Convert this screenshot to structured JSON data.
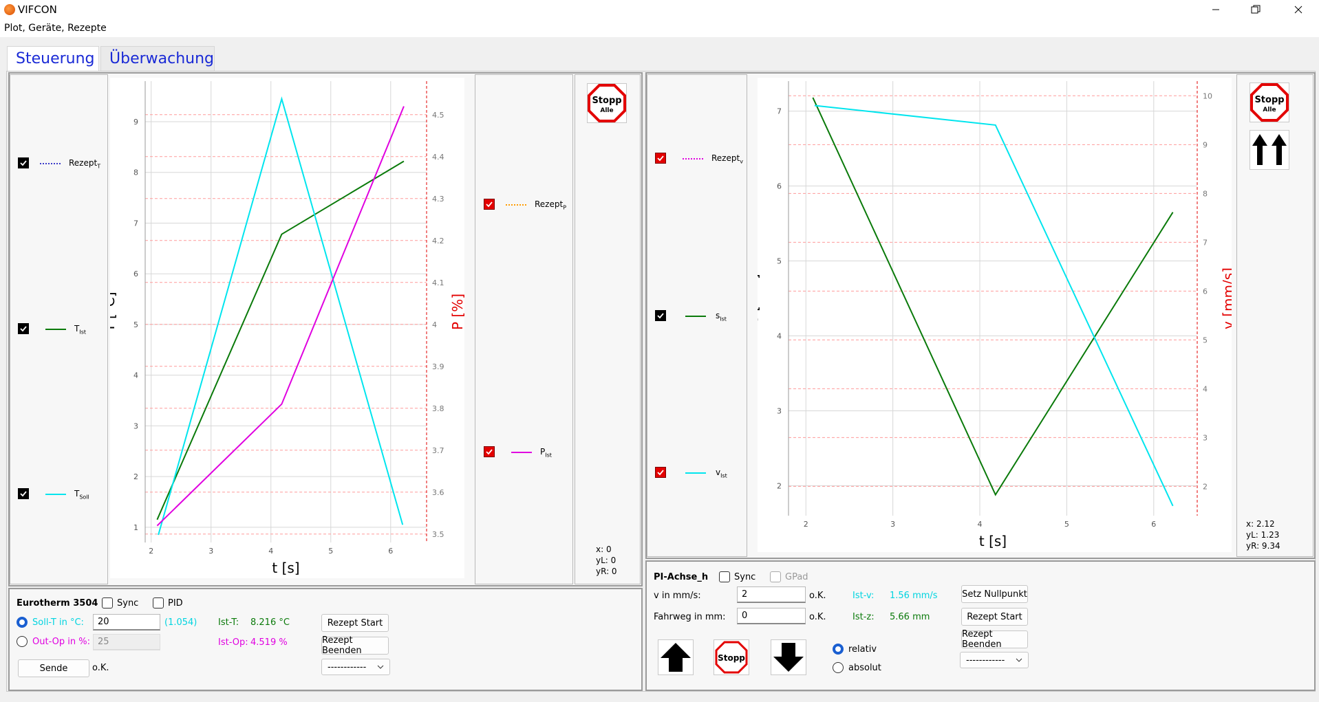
{
  "window": {
    "title": "VIFCON",
    "menu": "Plot, Geräte, Rezepte",
    "controls": {
      "minimize_icon": "minimize-icon",
      "maximize_icon": "maximize-icon",
      "close_icon": "close-icon"
    }
  },
  "tabs": [
    {
      "label": "Steuerung",
      "active": true
    },
    {
      "label": "Überwachung",
      "active": false
    }
  ],
  "colors": {
    "accent": "#1a2ad6",
    "cyan": "#00e5ee",
    "green": "#0a7a0a",
    "magenta": "#e000e0",
    "red": "#e30000",
    "orange": "#ff9c00",
    "blue": "#3a3ac8"
  },
  "left": {
    "legend_left": [
      {
        "name": "Rezept",
        "sub": "T",
        "style": "dotted",
        "color": "#3a3ac8"
      },
      {
        "name": "T",
        "sub": "Ist",
        "style": "solid",
        "color": "#0a7a0a"
      },
      {
        "name": "T",
        "sub": "Soll",
        "style": "solid",
        "color": "#00e5ee"
      }
    ],
    "legend_right": [
      {
        "name": "Rezept",
        "sub": "P",
        "style": "dotted",
        "color": "#ff9c00"
      },
      {
        "name": "P",
        "sub": "Ist",
        "style": "solid",
        "color": "#e000e0"
      }
    ],
    "stopp": {
      "label1": "Stopp",
      "label2": "Alle"
    },
    "coords": {
      "x": "x: 0",
      "yL": "yL: 0",
      "yR": "yR: 0"
    }
  },
  "right": {
    "legend_left": [
      {
        "name": "Rezept",
        "sub": "v",
        "style": "dotted",
        "color": "#e000e0"
      },
      {
        "name": "s",
        "sub": "Ist",
        "style": "solid",
        "color": "#0a7a0a"
      },
      {
        "name": "v",
        "sub": "Ist",
        "style": "solid",
        "color": "#00e5ee"
      }
    ],
    "stopp": {
      "label1": "Stopp",
      "label2": "Alle"
    },
    "up_icon": "double-up-arrow-icon",
    "coords": {
      "x": "x: 2.12",
      "yL": "yL: 1.23",
      "yR": "yR: 9.34"
    }
  },
  "eurotherm": {
    "title": "Eurotherm 3504",
    "sync": "Sync",
    "pid": "PID",
    "soll_label": "Soll-T in °C:",
    "soll_value": "20",
    "soll_extra": "(1.054)",
    "op_label": "Out-Op in %:",
    "op_value": "25",
    "ist_t_label": "Ist-T:",
    "ist_t_value": "8.216 °C",
    "ist_op_label": "Ist-Op:",
    "ist_op_value": "4.519 %",
    "sende": "Sende",
    "ok": "o.K.",
    "rezept_start": "Rezept Start",
    "rezept_beenden": "Rezept Beenden",
    "select": "------------"
  },
  "pi": {
    "title": "PI-Achse_h",
    "sync": "Sync",
    "gpad": "GPad",
    "v_label": "v in mm/s:",
    "v_value": "2",
    "ok1": "o.K.",
    "fw_label": "Fahrweg in mm:",
    "fw_value": "0",
    "ok2": "o.K.",
    "ist_v_label": "Ist-v:",
    "ist_v_value": "1.56 mm/s",
    "ist_z_label": "Ist-z:",
    "ist_z_value": "5.66 mm",
    "setz": "Setz Nullpunkt",
    "rezept_start": "Rezept Start",
    "rezept_beenden": "Rezept Beenden",
    "select": "------------",
    "stopp": "Stopp",
    "relativ": "relativ",
    "absolut": "absolut"
  },
  "chart_data": [
    {
      "type": "line",
      "xlabel": "t [s]",
      "ylabel": "T [°C]",
      "ylabel_right": "P [%]",
      "xlim": [
        1.9,
        6.6
      ],
      "ylim": [
        0.7,
        9.8
      ],
      "ylim_right": [
        3.48,
        4.58
      ],
      "xticks": [
        "2",
        "3",
        "4",
        "5",
        "6"
      ],
      "yticks": [
        "1",
        "2",
        "3",
        "4",
        "5",
        "6",
        "7",
        "8",
        "9"
      ],
      "yticks_right": [
        "3.5",
        "3.6",
        "3.7",
        "3.8",
        "3.9",
        "4",
        "4.1",
        "4.2",
        "4.3",
        "4.4",
        "4.5"
      ],
      "grid": true,
      "series": [
        {
          "name": "T_Ist",
          "axis": "left",
          "color": "#0a7a0a",
          "x": [
            2.1,
            4.18,
            6.22
          ],
          "y": [
            1.15,
            6.78,
            8.22
          ]
        },
        {
          "name": "T_Soll",
          "axis": "left",
          "color": "#00e5ee",
          "x": [
            2.12,
            4.18,
            6.2
          ],
          "y": [
            0.85,
            9.45,
            1.05
          ]
        },
        {
          "name": "P_Ist",
          "axis": "right",
          "color": "#e000e0",
          "x": [
            2.1,
            4.18,
            6.22
          ],
          "y": [
            3.52,
            3.81,
            4.52
          ]
        }
      ]
    },
    {
      "type": "line",
      "xlabel": "t [s]",
      "ylabel": "s [mm]",
      "ylabel_right": "v [mm/s]",
      "xlim": [
        1.8,
        6.5
      ],
      "ylim": [
        1.6,
        7.4
      ],
      "ylim_right": [
        1.4,
        10.3
      ],
      "xticks": [
        "2",
        "3",
        "4",
        "5",
        "6"
      ],
      "yticks": [
        "2",
        "3",
        "4",
        "5",
        "6",
        "7"
      ],
      "yticks_right": [
        "2",
        "3",
        "4",
        "5",
        "6",
        "7",
        "8",
        "9",
        "10"
      ],
      "grid": true,
      "series": [
        {
          "name": "s_Ist",
          "axis": "left",
          "color": "#0a7a0a",
          "x": [
            2.08,
            4.18,
            6.22
          ],
          "y": [
            7.18,
            1.88,
            5.65
          ]
        },
        {
          "name": "v_Ist",
          "axis": "right",
          "color": "#00e5ee",
          "x": [
            2.1,
            4.18,
            6.22
          ],
          "y": [
            9.8,
            9.4,
            1.6
          ]
        }
      ]
    }
  ]
}
